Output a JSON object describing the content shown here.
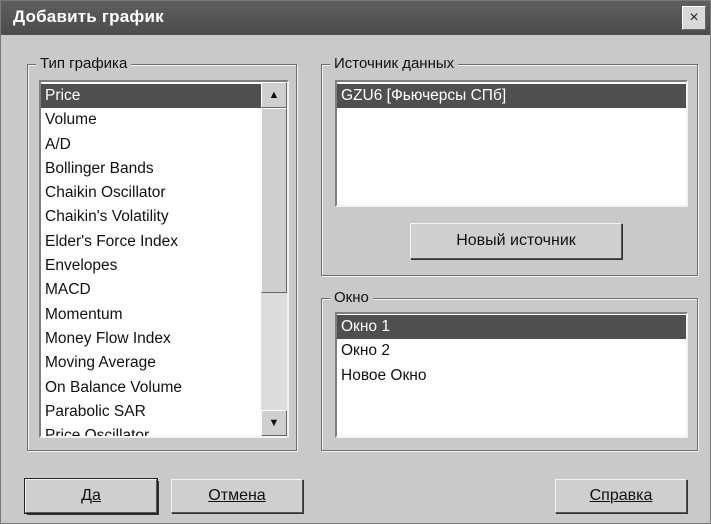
{
  "dialog": {
    "title": "Добавить график",
    "close_label": "×"
  },
  "chart_type": {
    "label": "Тип графика",
    "items": [
      "Price",
      "Volume",
      "A/D",
      "Bollinger Bands",
      "Chaikin Oscillator",
      "Chaikin's Volatility",
      "Elder's Force Index",
      "Envelopes",
      "MACD",
      "Momentum",
      "Money Flow Index",
      "Moving Average",
      "On Balance Volume",
      "Parabolic SAR",
      "Price Oscillator"
    ],
    "selected": "Price",
    "scroll_up_icon": "▲",
    "scroll_down_icon": "▼"
  },
  "data_source": {
    "label": "Источник данных",
    "items": [
      "GZU6 [Фьючерсы СПб]"
    ],
    "selected": "GZU6 [Фьючерсы СПб]",
    "new_source_label": "Новый источник"
  },
  "window_group": {
    "label": "Окно",
    "items": [
      "Окно 1",
      "Окно 2",
      "Новое Окно"
    ],
    "selected": "Окно 1"
  },
  "buttons": {
    "ok": "Да",
    "cancel": "Отмена",
    "help": "Справка"
  }
}
